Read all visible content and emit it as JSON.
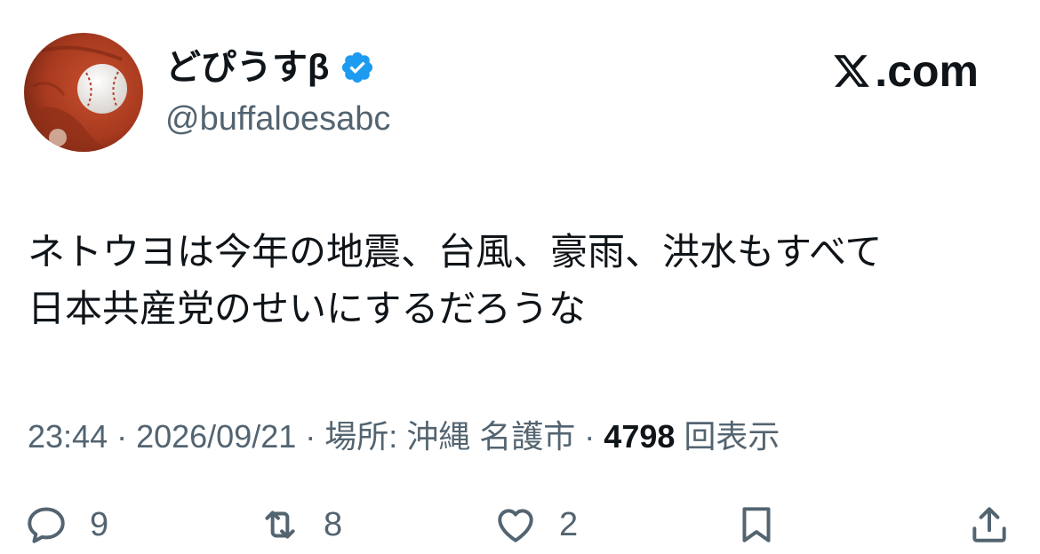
{
  "user": {
    "display_name": "どぴうすβ",
    "handle": "@buffaloesabc",
    "verified": true,
    "avatar_icon": "avatar-baseball-glove"
  },
  "brand": {
    "logo_icon": "x-logo-icon",
    "domain": ".com"
  },
  "tweet": {
    "lines": [
      "ネトウヨは今年の地震、台風、豪雨、洪水もすべて",
      "日本共産党のせいにするだろうな"
    ]
  },
  "meta": {
    "time": "23:44",
    "sep1": " · ",
    "date": "2026/09/21",
    "sep2": " · ",
    "location": "場所: 沖縄 名護市",
    "sep3": " · ",
    "views_count": "4798",
    "views_label": "回表示"
  },
  "actions": {
    "replies": "9",
    "reposts": "8",
    "likes": "2"
  },
  "colors": {
    "text": "#0f1419",
    "secondary": "#536471",
    "verified_blue": "#1d9bf0"
  }
}
